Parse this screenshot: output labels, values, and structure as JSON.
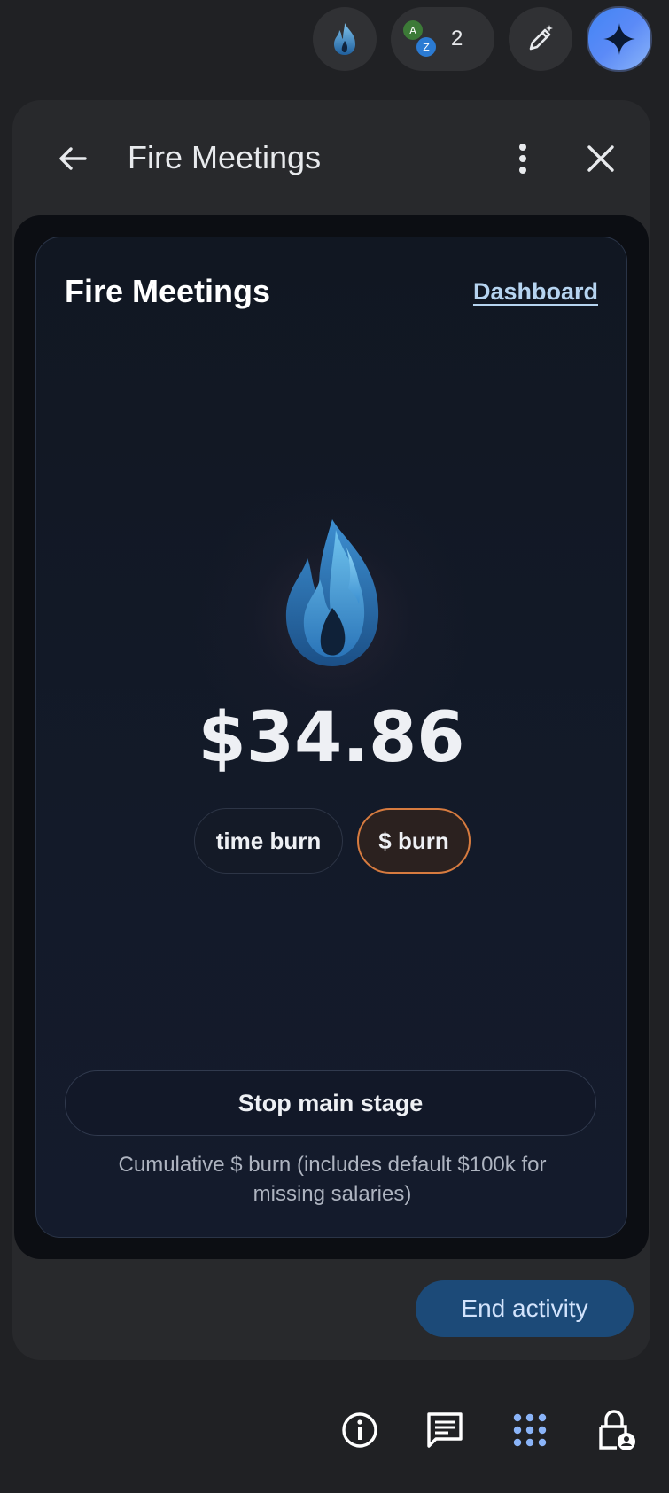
{
  "topbar": {
    "participant_count": "2",
    "avatar_a": "A",
    "avatar_z": "Z",
    "icons": [
      "fire-addon-icon",
      "people-icon",
      "pen-sparkle-icon",
      "gemini-icon"
    ]
  },
  "panel": {
    "title": "Fire Meetings",
    "icons": [
      "back-arrow-icon",
      "more-vert-icon",
      "close-icon"
    ]
  },
  "addon": {
    "title": "Fire Meetings",
    "dashboard_link": "Dashboard",
    "amount": "$34.86",
    "toggles": [
      "time burn",
      "$ burn"
    ],
    "selected_toggle": "$ burn",
    "stop_button": "Stop main stage",
    "footnote": "Cumulative $ burn (includes default $100k for missing salaries)"
  },
  "end_activity": "End activity",
  "bottom_icons": [
    "info-icon",
    "chat-icon",
    "apps-grid-icon",
    "lock-person-icon"
  ],
  "colors": {
    "background": "#202124",
    "panel": "#28292c",
    "card": "#131a29",
    "accent_orange": "#d77b3f",
    "link": "#b6d4f0",
    "end_button": "#1c4a78"
  }
}
